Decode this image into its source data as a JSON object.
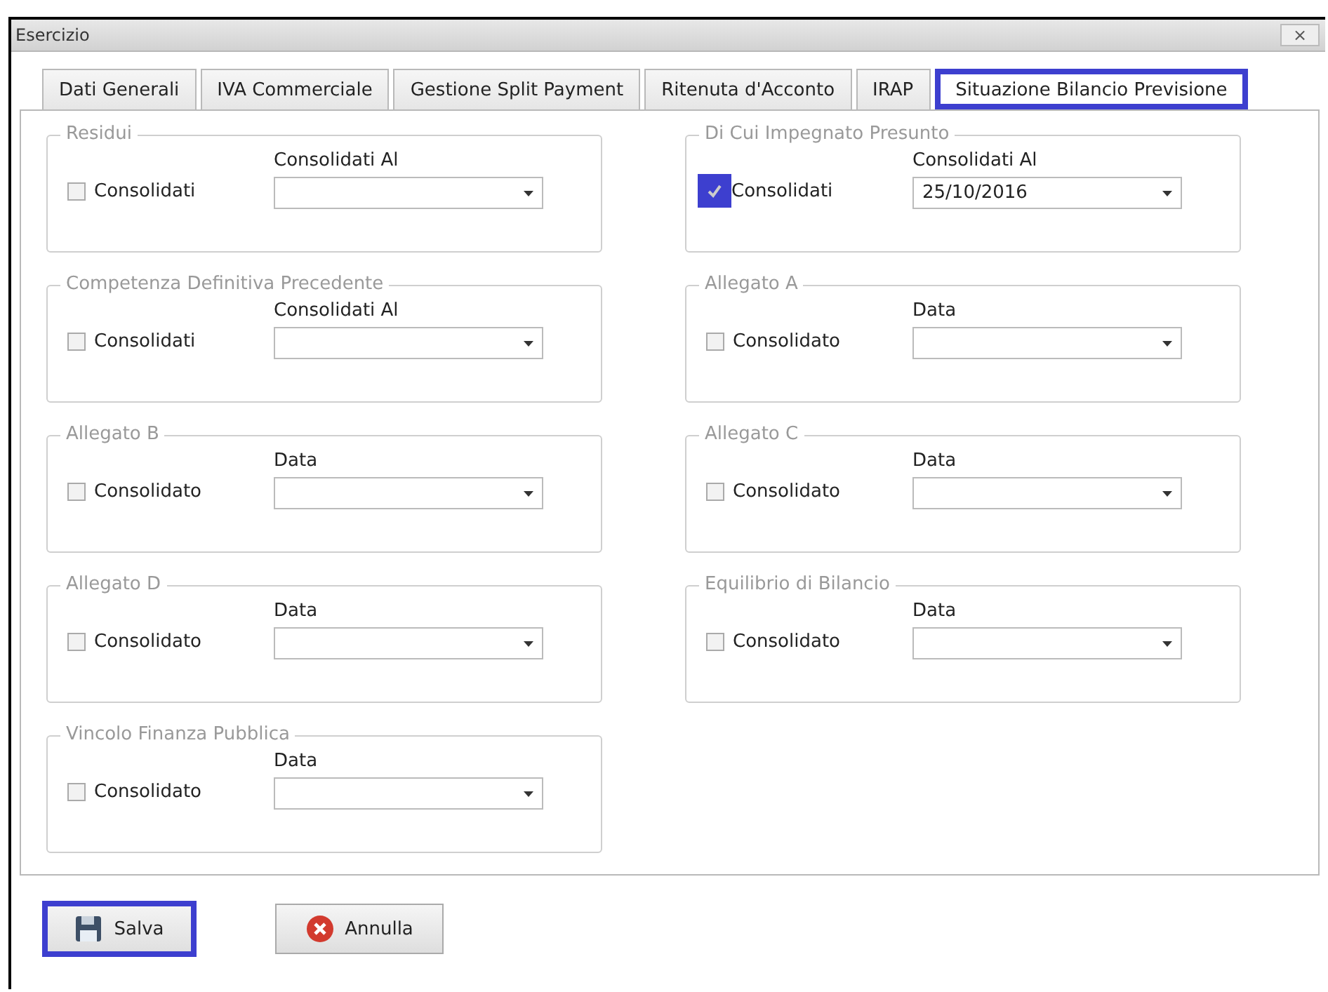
{
  "window": {
    "title": "Esercizio",
    "close": "×"
  },
  "tabs": [
    {
      "label": "Dati Generali",
      "selected": false,
      "highlighted": false
    },
    {
      "label": "IVA Commerciale",
      "selected": false,
      "highlighted": false
    },
    {
      "label": "Gestione Split Payment",
      "selected": false,
      "highlighted": false
    },
    {
      "label": "Ritenuta d'Acconto",
      "selected": false,
      "highlighted": false
    },
    {
      "label": "IRAP",
      "selected": false,
      "highlighted": false
    },
    {
      "label": "Situazione Bilancio Previsione",
      "selected": true,
      "highlighted": true
    }
  ],
  "groups": [
    {
      "title": "Residui",
      "checkbox": "Consolidati",
      "checked": false,
      "highlighted": false,
      "field_label": "Consolidati Al"
    },
    {
      "title": "Di Cui Impegnato Presunto",
      "checkbox": "Consolidati",
      "checked": true,
      "highlighted": true,
      "field_label": "Consolidati Al",
      "value": "25/10/2016"
    },
    {
      "title": "Competenza Definitiva Precedente",
      "checkbox": "Consolidati",
      "checked": false,
      "highlighted": false,
      "field_label": "Consolidati Al"
    },
    {
      "title": "Allegato A",
      "checkbox": "Consolidato",
      "checked": false,
      "highlighted": false,
      "field_label": "Data"
    },
    {
      "title": "Allegato B",
      "checkbox": "Consolidato",
      "checked": false,
      "highlighted": false,
      "field_label": "Data"
    },
    {
      "title": "Allegato C",
      "checkbox": "Consolidato",
      "checked": false,
      "highlighted": false,
      "field_label": "Data"
    },
    {
      "title": "Allegato D",
      "checkbox": "Consolidato",
      "checked": false,
      "highlighted": false,
      "field_label": "Data"
    },
    {
      "title": "Equilibrio di Bilancio",
      "checkbox": "Consolidato",
      "checked": false,
      "highlighted": false,
      "field_label": "Data"
    },
    {
      "title": "Vincolo Finanza Pubblica",
      "checkbox": "Consolidato",
      "checked": false,
      "highlighted": false,
      "field_label": "Data"
    }
  ],
  "buttons": [
    {
      "label": "Salva",
      "kind": "save",
      "highlighted": true
    },
    {
      "label": "Annulla",
      "kind": "cancel",
      "highlighted": false
    }
  ]
}
